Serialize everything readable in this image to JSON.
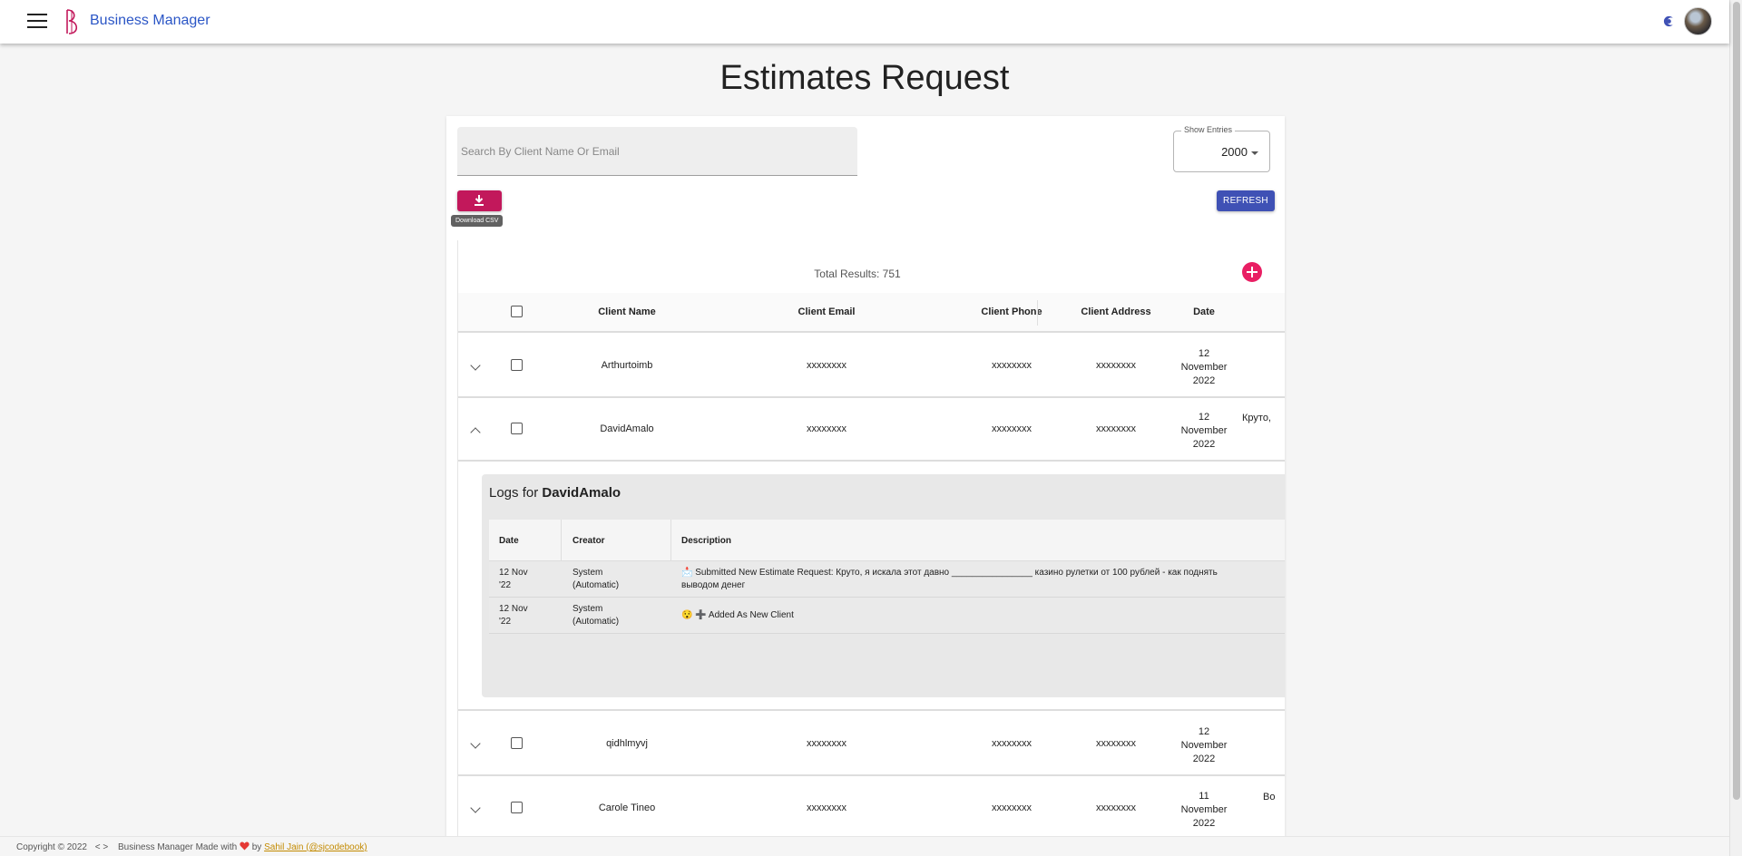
{
  "app": {
    "brand": "Business Manager"
  },
  "page": {
    "title": "Estimates Request"
  },
  "search": {
    "placeholder": "Search By Client Name Or Email"
  },
  "entries": {
    "label": "Show Entries",
    "value": "2000"
  },
  "toolbar": {
    "download_tooltip": "Download CSV",
    "refresh_label": "REFRESH"
  },
  "results": {
    "total_text": "Total Results: 751"
  },
  "table": {
    "columns": [
      "Client Name",
      "Client Email",
      "Client Phone",
      "Client Address",
      "Date"
    ],
    "rows": [
      {
        "name": "Arthurtoimb",
        "email": "xxxxxxxx",
        "phone": "xxxxxxxx",
        "address": "xxxxxxxx",
        "date": [
          "12",
          "November",
          "2022"
        ],
        "extra": "",
        "expanded": false
      },
      {
        "name": "DavidAmalo",
        "email": "xxxxxxxx",
        "phone": "xxxxxxxx",
        "address": "xxxxxxxx",
        "date": [
          "12",
          "November",
          "2022"
        ],
        "extra": "Круто,",
        "expanded": true
      },
      {
        "name": "qidhlmyvj",
        "email": "xxxxxxxx",
        "phone": "xxxxxxxx",
        "address": "xxxxxxxx",
        "date": [
          "12",
          "November",
          "2022"
        ],
        "extra": "",
        "expanded": false
      },
      {
        "name": "Carole Tineo",
        "email": "xxxxxxxx",
        "phone": "xxxxxxxx",
        "address": "xxxxxxxx",
        "date": [
          "11",
          "November",
          "2022"
        ],
        "extra": "Bo",
        "expanded": false
      }
    ]
  },
  "logs": {
    "title_prefix": "Logs for",
    "title_name": "DavidAmalo",
    "columns": [
      "Date",
      "Creator",
      "Description"
    ],
    "rows": [
      {
        "date": [
          "12 Nov",
          "'22"
        ],
        "creator": [
          "System",
          "(Automatic)"
        ],
        "description": [
          "📩 Submitted New Estimate Request: Круто, я искала этот давно ________________ казино рулетки от 100 рублей - как поднять",
          "выводом денег"
        ]
      },
      {
        "date": [
          "12 Nov",
          "'22"
        ],
        "creator": [
          "System",
          "(Automatic)"
        ],
        "description": [
          "😯 ➕ Added As New Client",
          ""
        ]
      }
    ]
  },
  "footer": {
    "copyright": "Copyright © 2022",
    "code_sign": "< >",
    "made_with": "Business Manager Made with",
    "by": "by",
    "author": "Sahil Jain (@sjcodebook)"
  },
  "colors": {
    "brand": "#2b56c6",
    "download": "#c2185b",
    "refresh": "#3f51b5",
    "add": "#e91e63"
  }
}
